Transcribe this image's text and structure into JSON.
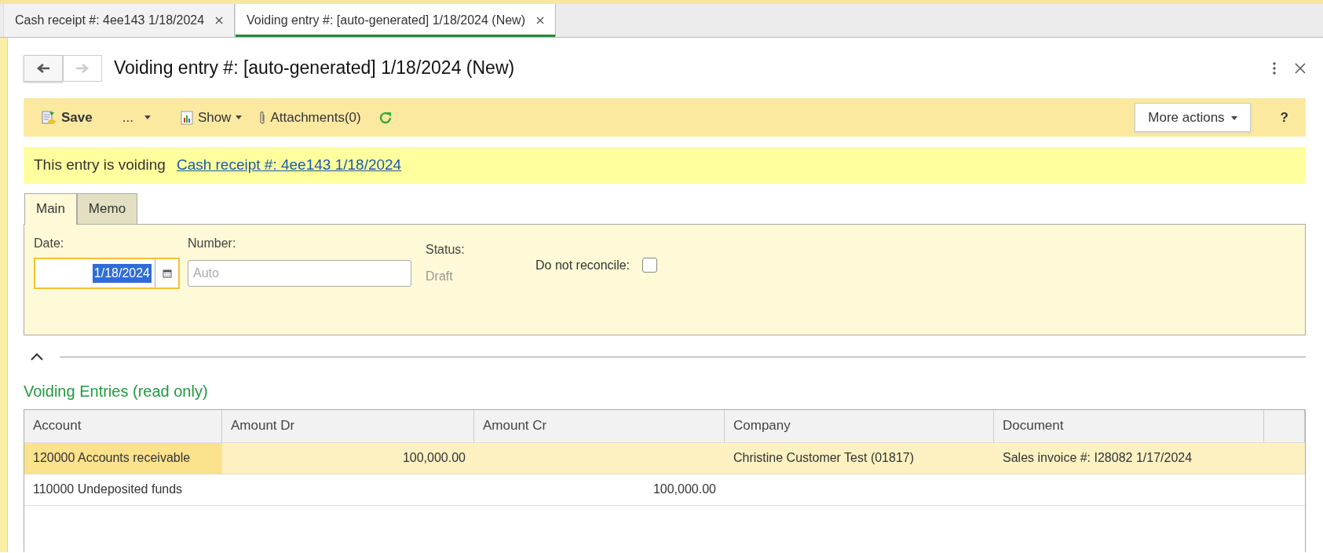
{
  "tabs": [
    {
      "label": "Cash receipt #: 4ee143 1/18/2024",
      "selected": false
    },
    {
      "label": "Voiding entry #: [auto-generated] 1/18/2024 (New)",
      "selected": true
    }
  ],
  "header": {
    "nav": [
      {
        "kind": "back",
        "disabled": false
      },
      {
        "kind": "forward",
        "disabled": true
      }
    ],
    "title": "Voiding entry #: [auto-generated] 1/18/2024 (New)"
  },
  "toolbar": {
    "save": "Save",
    "more": "...",
    "show": "Show",
    "attachments": "Attachments(0)",
    "more_actions": "More actions",
    "help": "?"
  },
  "banner": {
    "text": "This entry is voiding",
    "link": "Cash receipt #: 4ee143 1/18/2024"
  },
  "form_tabs": [
    {
      "label": "Main",
      "selected": true
    },
    {
      "label": "Memo",
      "selected": false
    }
  ],
  "form": {
    "date_label": "Date:",
    "date_value": "1/18/2024",
    "number_label": "Number:",
    "number_placeholder": "Auto",
    "status_label": "Status:",
    "status_value": "Draft",
    "reconcile_label": "Do not reconcile:",
    "reconcile_checked": false
  },
  "section_title": "Voiding Entries (read only)",
  "table": {
    "columns": [
      "Account",
      "Amount Dr",
      "Amount Cr",
      "Company",
      "Document"
    ],
    "rows": [
      {
        "selected": true,
        "cells": [
          "120000 Accounts receivable",
          "100,000.00",
          "",
          "Christine Customer Test (01817)",
          "Sales invoice #: I28082 1/17/2024"
        ]
      },
      {
        "selected": false,
        "cells": [
          "110000 Undeposited funds",
          "",
          "100,000.00",
          "",
          ""
        ]
      }
    ]
  }
}
